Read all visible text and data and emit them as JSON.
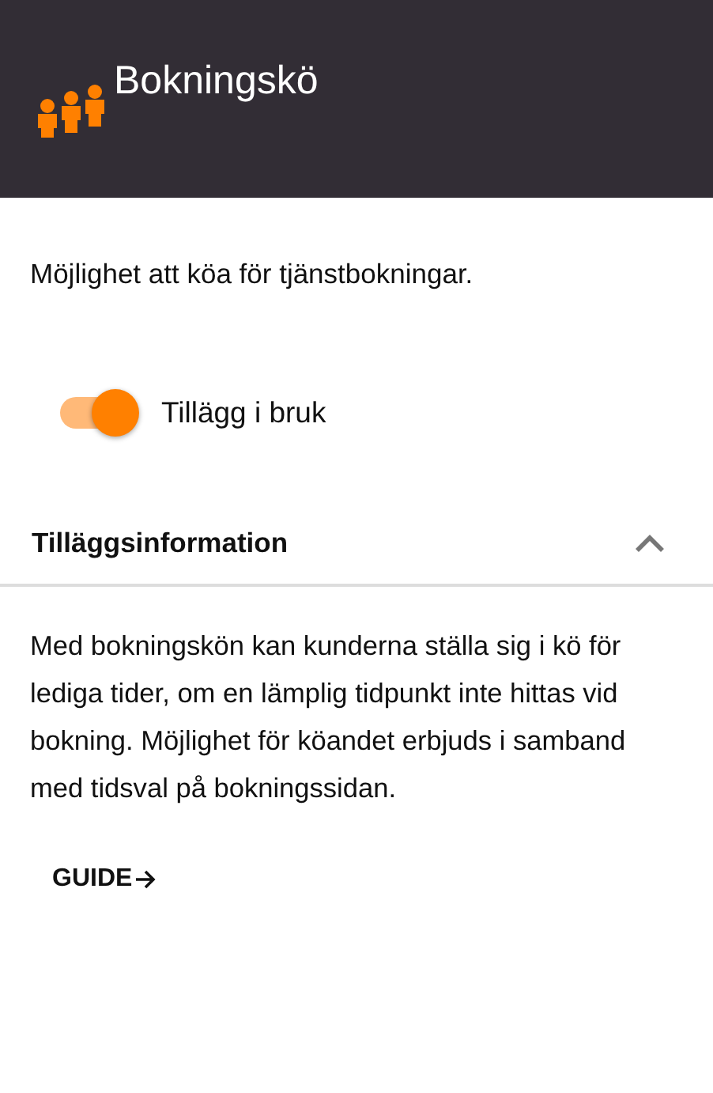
{
  "header": {
    "title": "Bokningskö"
  },
  "description": "Möjlighet att köa för tjänstbokningar.",
  "toggle": {
    "label": "Tillägg i bruk",
    "on": true
  },
  "accordion": {
    "title": "Tilläggsinformation",
    "expanded": true,
    "body": "Med bokningskön kan kunderna ställa sig i kö för lediga tider, om en lämplig tidpunkt inte hittas vid bokning. Möjlighet för köandet erbjuds i samband med tidsval på bokningssidan.",
    "link": "GUIDE"
  }
}
